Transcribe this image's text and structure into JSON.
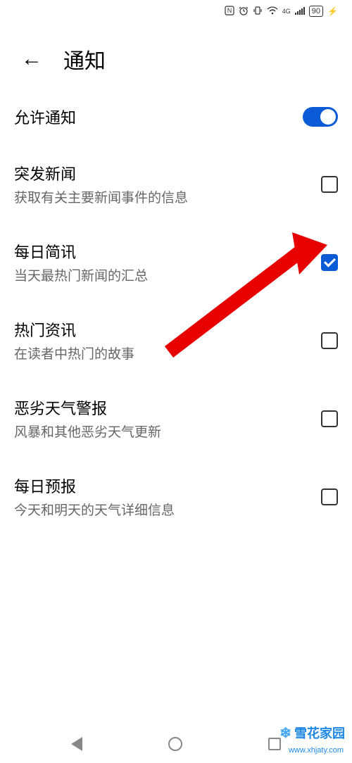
{
  "status_bar": {
    "nfc": "N",
    "alarm": "⏰",
    "vibrate": "📳",
    "wifi": "📶",
    "network": "4G",
    "signal": "📶",
    "battery": "90",
    "charging": "⚡"
  },
  "header": {
    "title": "通知",
    "back": "←"
  },
  "settings": {
    "allow": {
      "title": "允许通知",
      "enabled": true
    },
    "items": [
      {
        "title": "突发新闻",
        "subtitle": "获取有关主要新闻事件的信息",
        "checked": false
      },
      {
        "title": "每日简讯",
        "subtitle": "当天最热门新闻的汇总",
        "checked": true
      },
      {
        "title": "热门资讯",
        "subtitle": "在读者中热门的故事",
        "checked": false
      },
      {
        "title": "恶劣天气警报",
        "subtitle": "风暴和其他恶劣天气更新",
        "checked": false
      },
      {
        "title": "每日预报",
        "subtitle": "今天和明天的天气详细信息",
        "checked": false
      }
    ]
  },
  "watermark": {
    "text": "雪花家园",
    "url": "www.xhjaty.com"
  }
}
